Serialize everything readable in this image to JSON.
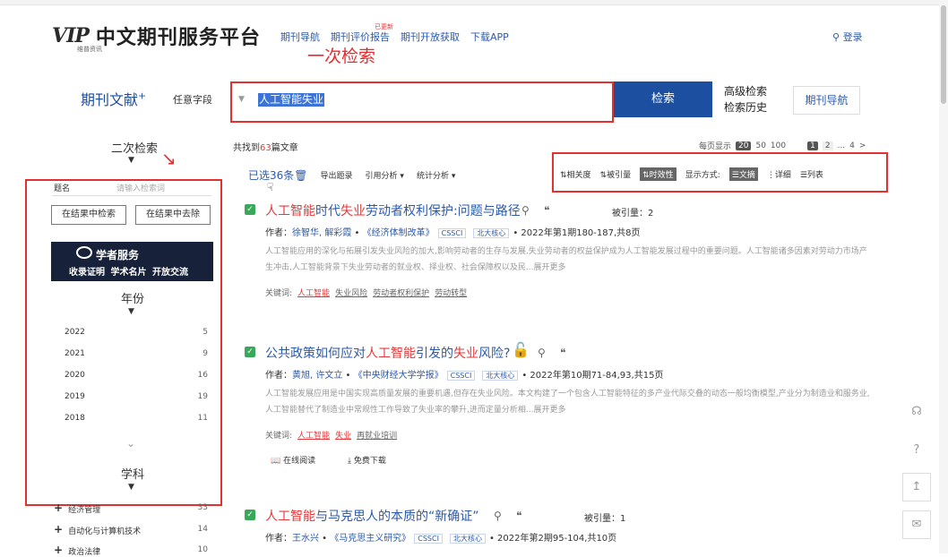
{
  "header": {
    "logo_text": "VIP",
    "logo_sub": "维普资讯",
    "title": "中文期刊服务平台",
    "nav": [
      "期刊导航",
      "期刊评价报告",
      "期刊开放获取",
      "下载APP"
    ],
    "nav_badge": "已更新",
    "login": "登录"
  },
  "annotation": {
    "label1": "一次检索"
  },
  "search": {
    "tab": "期刊文献",
    "tab_plus": "+",
    "field": "任意字段",
    "query": "人工智能失业",
    "button": "检索",
    "advanced": "高级检索",
    "history": "检索历史",
    "journal_nav": "期刊导航"
  },
  "left": {
    "second_search": "二次检索",
    "select_value": "题名",
    "placeholder": "请输入检索词",
    "btn_in": "在结果中检索",
    "btn_out": "在结果中去除",
    "banner": {
      "title": "学者服务",
      "sub": "收录证明 学术名片 开放交流"
    },
    "year_title": "年份",
    "years": [
      {
        "year": "2022",
        "count": "5"
      },
      {
        "year": "2021",
        "count": "9"
      },
      {
        "year": "2020",
        "count": "16"
      },
      {
        "year": "2019",
        "count": "19"
      },
      {
        "year": "2018",
        "count": "11"
      }
    ],
    "subject_title": "学科",
    "subjects": [
      {
        "name": "经济管理",
        "count": "33"
      },
      {
        "name": "自动化与计算机技术",
        "count": "14"
      },
      {
        "name": "政治法律",
        "count": "10"
      }
    ]
  },
  "results": {
    "found_pre": "共找到",
    "found_num": "63",
    "found_post": "篇文章",
    "per_page_label": "每页显示",
    "per_page": [
      "20",
      "50",
      "100"
    ],
    "pages": [
      "1",
      "2",
      "...",
      "4",
      ">"
    ],
    "selected": "已选36条",
    "actions": [
      "导出题录",
      "引用分析",
      "统计分析"
    ],
    "sort": [
      "相关度",
      "被引量",
      "时效性"
    ],
    "display_label": "显示方式:",
    "display": [
      "文摘",
      "详细",
      "列表"
    ],
    "items": [
      {
        "title_parts": [
          [
            "人工智能",
            "red"
          ],
          [
            "时代",
            ""
          ],
          [
            "失业",
            "red"
          ],
          [
            "劳动者权利保护:问题与路径",
            ""
          ]
        ],
        "cited": "被引量：2",
        "author_label": "作者：",
        "authors": "徐智华, 解彩霞",
        "journal": "《经济体制改革》",
        "tags": [
          "CSSCI",
          "北大核心"
        ],
        "issue": "• 2022年第1期180-187,共8页",
        "abstract": "人工智能应用的深化与拓展引发失业风险的加大,影响劳动者的生存与发展,失业劳动者的权益保护成为人工智能发展过程中的重要问题。人工智能诸多因素对劳动力市场产生冲击,人工智能背景下失业劳动者的就业权、择业权、社会保障权以及民...展开更多",
        "kw_label": "关键词:",
        "keywords": [
          "人工智能",
          "失业风险",
          "劳动者权利保护",
          "劳动转型"
        ]
      },
      {
        "title_parts": [
          [
            "公共政策如何应对",
            ""
          ],
          [
            "人工智能",
            "red"
          ],
          [
            "引发的",
            ""
          ],
          [
            "失业",
            "red"
          ],
          [
            "风险?",
            ""
          ]
        ],
        "cited": "",
        "author_label": "作者：",
        "authors": "黄旭, 许文立",
        "journal": "《中央财经大学学报》",
        "tags": [
          "CSSCI",
          "北大核心"
        ],
        "issue": "• 2022年第10期71-84,93,共15页",
        "abstract": "人工智能发展应用是中国实现高质量发展的重要机遇,但存在失业风险。本文构建了一个包含人工智能特征的多产业代际交叠的动态一般均衡模型,产业分为制造业和服务业,人工智能替代了制造业中常规性工作导致了失业率的攀升,进而定量分析相...展开更多",
        "kw_label": "关键词:",
        "keywords": [
          "人工智能",
          "失业",
          "再就业培训"
        ],
        "read": "在线阅读",
        "download": "免费下载"
      },
      {
        "title_parts": [
          [
            "人工智能",
            "red"
          ],
          [
            "与马克思人的本质的“新确证”",
            ""
          ]
        ],
        "cited": "被引量：1",
        "author_label": "作者：",
        "authors": "王水兴",
        "journal": "《马克思主义研究》",
        "tags": [
          "CSSCI",
          "北大核心"
        ],
        "issue": "• 2022年第2期95-104,共10页"
      }
    ]
  }
}
